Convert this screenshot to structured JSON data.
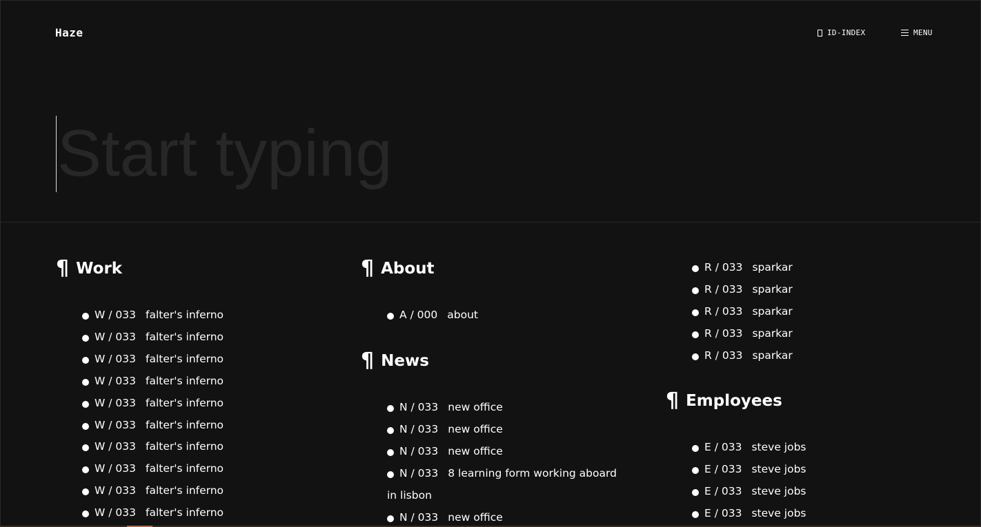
{
  "header": {
    "brand": "Haze",
    "id_index_label": "ID-INDEX",
    "menu_label": "MENU"
  },
  "search": {
    "placeholder": "Start typing",
    "value": ""
  },
  "work": {
    "title": "Work",
    "items": [
      {
        "code": "W / 033",
        "label": "falter's inferno"
      },
      {
        "code": "W / 033",
        "label": "falter's inferno"
      },
      {
        "code": "W / 033",
        "label": "falter's inferno"
      },
      {
        "code": "W / 033",
        "label": "falter's inferno"
      },
      {
        "code": "W / 033",
        "label": "falter's inferno"
      },
      {
        "code": "W / 033",
        "label": "falter's inferno"
      },
      {
        "code": "W / 033",
        "label": "falter's inferno"
      },
      {
        "code": "W / 033",
        "label": "falter's inferno"
      },
      {
        "code": "W / 033",
        "label": "falter's inferno"
      },
      {
        "code": "W / 033",
        "label": "falter's inferno"
      }
    ]
  },
  "about": {
    "title": "About",
    "items": [
      {
        "code": "A / 000",
        "label": "about"
      }
    ]
  },
  "news": {
    "title": "News",
    "items": [
      {
        "code": "N / 033",
        "label": "new office"
      },
      {
        "code": "N / 033",
        "label": "new office"
      },
      {
        "code": "N / 033",
        "label": "new office"
      },
      {
        "code": "N / 033",
        "label": "8 learning form working aboard in lisbon"
      },
      {
        "code": "N / 033",
        "label": "new office"
      }
    ]
  },
  "r_items": [
    {
      "code": "R / 033",
      "label": "sparkar"
    },
    {
      "code": "R / 033",
      "label": "sparkar"
    },
    {
      "code": "R / 033",
      "label": "sparkar"
    },
    {
      "code": "R / 033",
      "label": "sparkar"
    },
    {
      "code": "R / 033",
      "label": "sparkar"
    }
  ],
  "employees": {
    "title": "Employees",
    "items": [
      {
        "code": "E / 033",
        "label": "steve jobs"
      },
      {
        "code": "E / 033",
        "label": "steve jobs"
      },
      {
        "code": "E / 033",
        "label": "steve jobs"
      },
      {
        "code": "E / 033",
        "label": "steve jobs"
      }
    ]
  },
  "icons": {
    "section": "pilcrow-icon",
    "bullet": "bullet-icon",
    "id_index": "bookmark-icon",
    "menu": "hamburger-icon"
  },
  "colors": {
    "background": "#121212",
    "text": "#ffffff",
    "placeholder": "#272727",
    "accent": "#b5694a"
  }
}
